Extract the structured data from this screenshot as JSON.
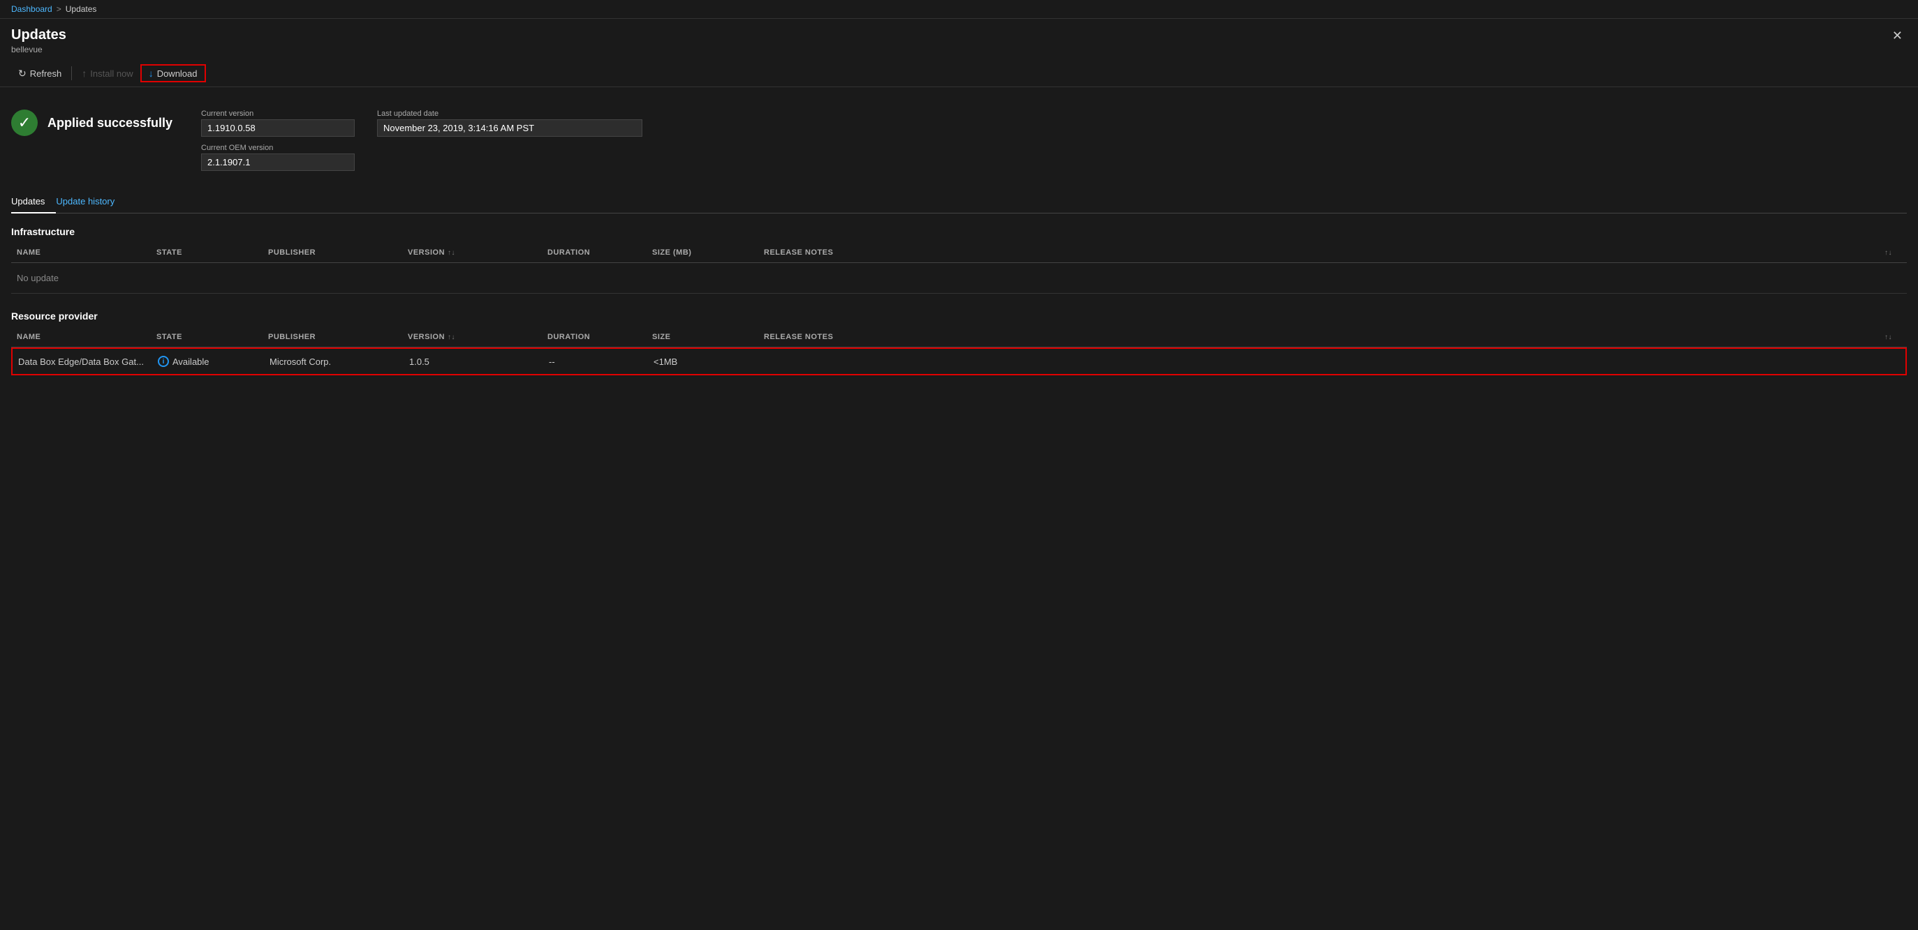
{
  "breadcrumb": {
    "parent": "Dashboard",
    "separator": ">",
    "current": "Updates"
  },
  "panel": {
    "title": "Updates",
    "subtitle": "bellevue",
    "close_label": "✕"
  },
  "toolbar": {
    "refresh_label": "Refresh",
    "install_label": "Install now",
    "download_label": "Download"
  },
  "status": {
    "applied_text": "Applied successfully",
    "current_version_label": "Current version",
    "current_version_value": "1.1910.0.58",
    "current_oem_label": "Current OEM version",
    "current_oem_value": "2.1.1907.1",
    "last_updated_label": "Last updated date",
    "last_updated_value": "November 23, 2019, 3:14:16 AM PST"
  },
  "tabs": [
    {
      "label": "Updates",
      "active": true
    },
    {
      "label": "Update history",
      "active": false
    }
  ],
  "infrastructure": {
    "section_title": "Infrastructure",
    "columns": [
      "NAME",
      "STATE",
      "PUBLISHER",
      "VERSION",
      "",
      "DURATION",
      "SIZE (MB)",
      "RELEASE NOTES",
      ""
    ],
    "no_update_text": "No update"
  },
  "resource_provider": {
    "section_title": "Resource provider",
    "columns": [
      "NAME",
      "STATE",
      "PUBLISHER",
      "VERSION",
      "",
      "DURATION",
      "SIZE",
      "RELEASE NOTES",
      ""
    ],
    "rows": [
      {
        "name": "Data Box Edge/Data Box Gat...",
        "state": "Available",
        "publisher": "Microsoft Corp.",
        "version": "1.0.5",
        "duration": "--",
        "size": "<1MB",
        "release_notes": ""
      }
    ]
  },
  "icons": {
    "refresh": "↻",
    "install": "↑",
    "download": "↓",
    "check": "✓",
    "sort": "↑↓",
    "info": "i"
  }
}
